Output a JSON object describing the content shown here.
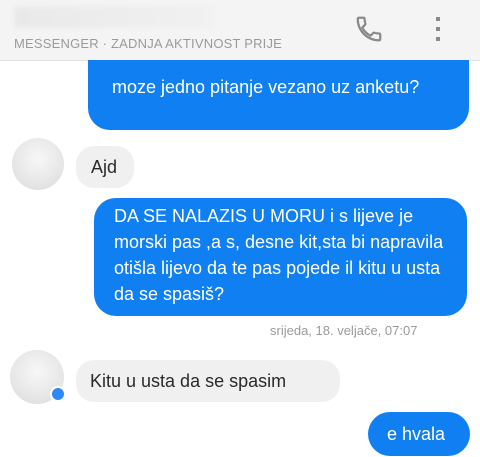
{
  "header": {
    "contact_name": "",
    "subtitle": "MESSENGER · ZADNJA AKTIVNOST PRIJE",
    "call_icon": "phone-icon",
    "menu_icon": "more-vertical-icon"
  },
  "messages": [
    {
      "direction": "outgoing",
      "text": "moze jedno pitanje vezano uz anketu?"
    },
    {
      "direction": "incoming",
      "text": "Ajd"
    },
    {
      "direction": "outgoing",
      "text": "DA SE NALAZIS U MORU i s lijeve je morski pas ,a s, desne kit,sta bi napravila otišla lijevo da te pas pojede il kitu u usta da se spasiš?"
    },
    {
      "direction": "incoming",
      "text": "Kitu u usta da se spasim"
    },
    {
      "direction": "outgoing",
      "text": "e hvala"
    }
  ],
  "timestamp": "srijeda, 18. veljače, 07:07",
  "colors": {
    "outgoing_bubble": "#0f7ff2",
    "incoming_bubble": "#f0f0f0",
    "header_background": "#f4f4f4",
    "accent": "#2e88f5"
  }
}
